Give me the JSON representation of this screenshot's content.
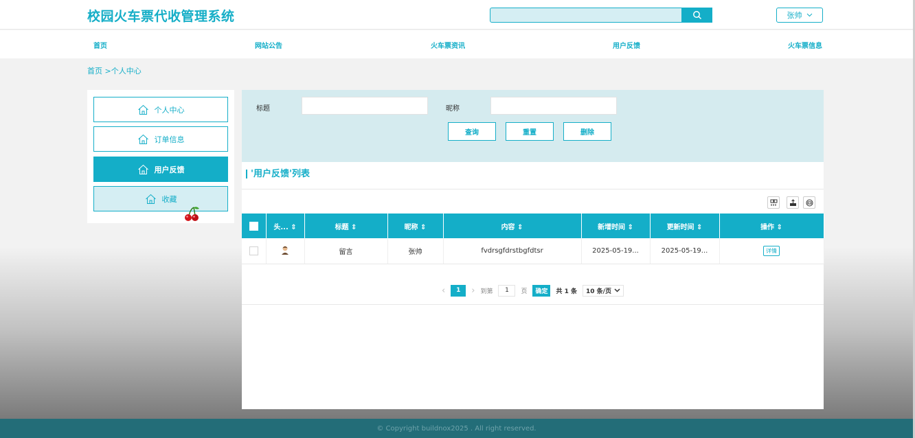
{
  "header": {
    "title": "校园火车票代收管理系统",
    "user": "张帅"
  },
  "nav": [
    {
      "label": "首页"
    },
    {
      "label": "网站公告"
    },
    {
      "label": "火车票资讯"
    },
    {
      "label": "用户反馈"
    },
    {
      "label": "火车票信息"
    }
  ],
  "breadcrumb": "首页 >个人中心",
  "sidebar": [
    {
      "label": "个人中心"
    },
    {
      "label": "订单信息"
    },
    {
      "label": "用户反馈"
    },
    {
      "label": "收藏"
    }
  ],
  "filter": {
    "title_label": "标题",
    "nickname_label": "昵称",
    "query": "查询",
    "reset": "重置",
    "delete": "删除"
  },
  "list": {
    "title": "'用户反馈'列表",
    "columns": [
      "头...",
      "标题",
      "昵称",
      "内容",
      "新增时间",
      "更新时间",
      "操作"
    ],
    "rows": [
      {
        "title": "留言",
        "nickname": "张帅",
        "content": "fvdrsgfdrstbgfdtsr",
        "created": "2025-05-19...",
        "updated": "2025-05-19...",
        "action": "详情"
      }
    ]
  },
  "pager": {
    "prev": "‹",
    "current": "1",
    "next": "›",
    "goto": "到第",
    "page_input": "1",
    "page_unit": "页",
    "confirm": "确定",
    "total": "共 1 条",
    "per_page": "10 条/页"
  },
  "footer": "© Copyright buildnox2025 . All right reserved.",
  "colors": {
    "accent": "#14aec8",
    "filter_bg": "#d5ebef",
    "footer_bg": "#236d78"
  }
}
